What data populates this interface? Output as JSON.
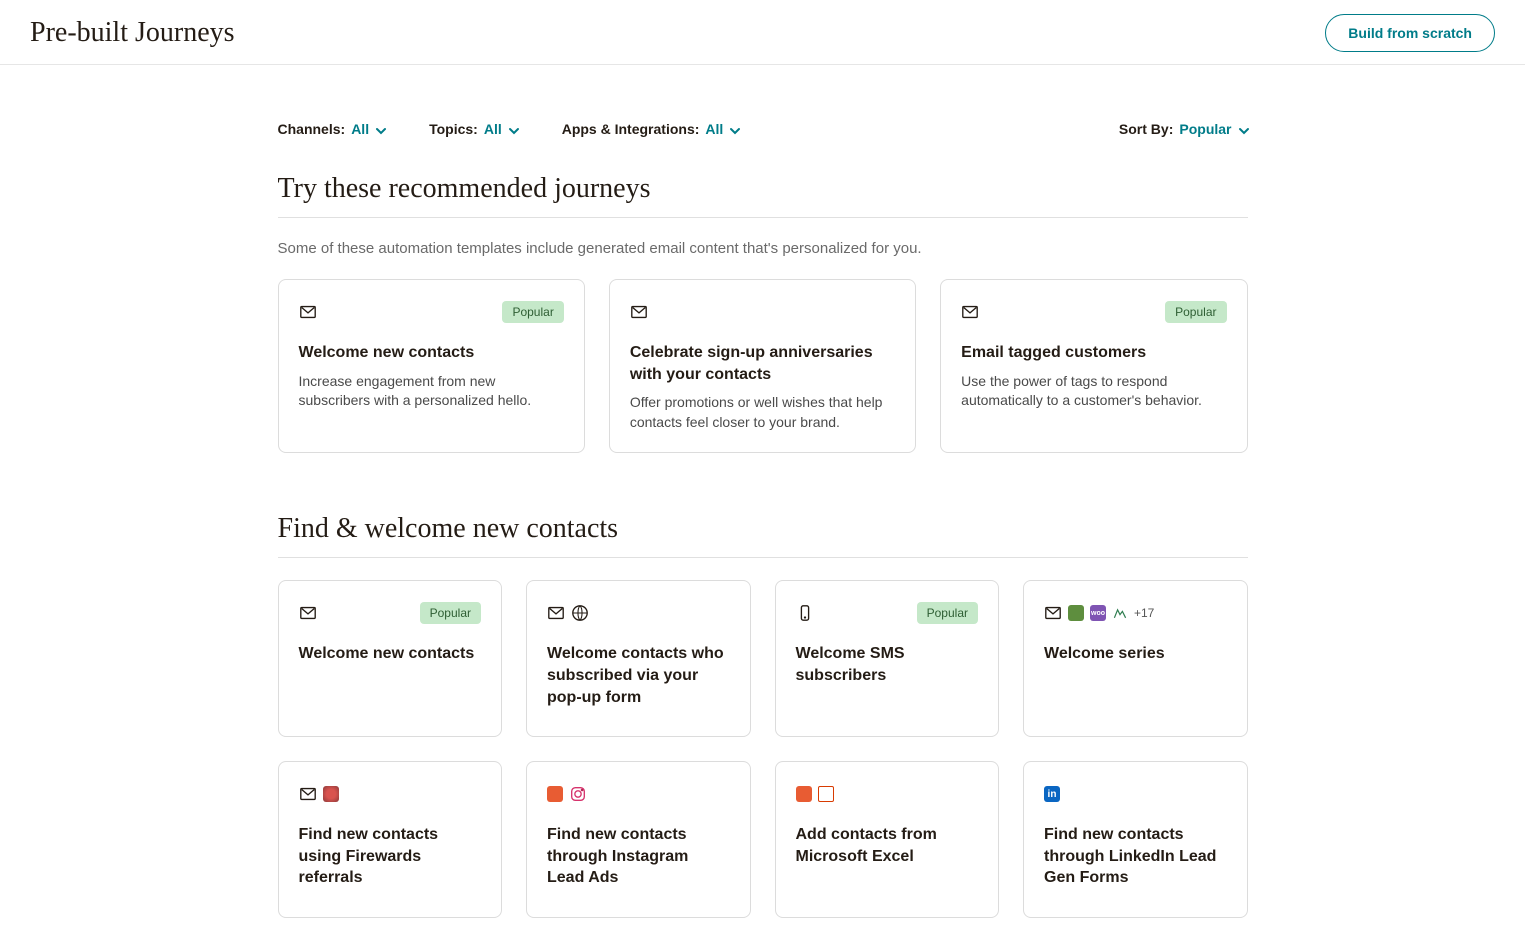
{
  "header": {
    "title": "Pre-built Journeys",
    "build_button": "Build from scratch"
  },
  "filters": {
    "channels_label": "Channels:",
    "channels_value": "All",
    "topics_label": "Topics:",
    "topics_value": "All",
    "apps_label": "Apps & Integrations:",
    "apps_value": "All",
    "sort_label": "Sort By:",
    "sort_value": "Popular"
  },
  "badges": {
    "popular": "Popular"
  },
  "recommended": {
    "title": "Try these recommended journeys",
    "subtitle": "Some of these automation templates include generated email content that's personalized for you.",
    "cards": [
      {
        "title": "Welcome new contacts",
        "desc": "Increase engagement from new subscribers with a personalized hello.",
        "popular": true
      },
      {
        "title": "Celebrate sign-up anniversaries with your contacts",
        "desc": "Offer promotions or well wishes that help contacts feel closer to your brand.",
        "popular": false
      },
      {
        "title": "Email tagged customers",
        "desc": "Use the power of tags to respond automatically to a customer's behavior.",
        "popular": true
      }
    ]
  },
  "find_welcome": {
    "title": "Find & welcome new contacts",
    "row1": [
      {
        "title": "Welcome new contacts",
        "popular": true
      },
      {
        "title": "Welcome contacts who subscribed via your pop-up form",
        "popular": false
      },
      {
        "title": "Welcome SMS subscribers",
        "popular": true
      },
      {
        "title": "Welcome series",
        "more": "+17",
        "popular": false
      }
    ],
    "row2": [
      {
        "title": "Find new contacts using Firewards referrals"
      },
      {
        "title": "Find new contacts through Instagram Lead Ads"
      },
      {
        "title": "Add contacts from Microsoft Excel"
      },
      {
        "title": "Find new contacts through LinkedIn Lead Gen Forms"
      }
    ]
  }
}
